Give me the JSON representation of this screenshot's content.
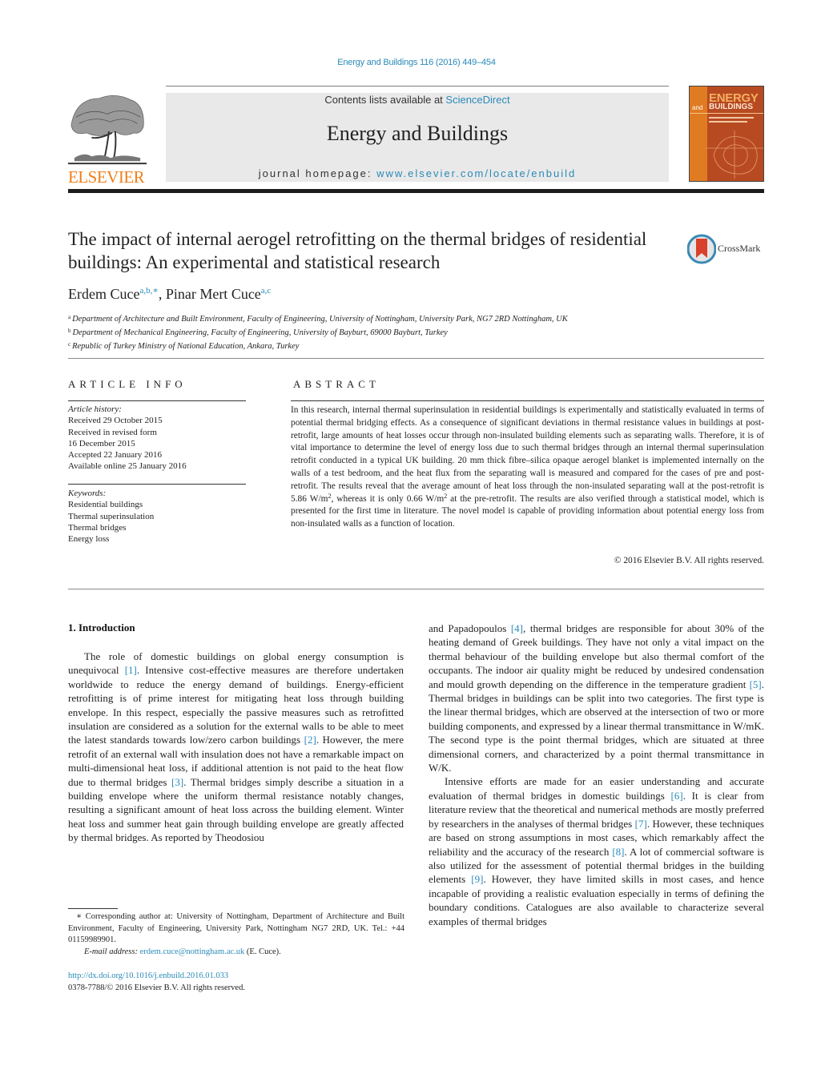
{
  "header": {
    "journal_citation": "Energy and Buildings 116 (2016) 449–454",
    "publisher_logo_text": "ELSEVIER",
    "contents_prefix": "Contents lists available at ",
    "contents_link": "ScienceDirect",
    "journal_title": "Energy and Buildings",
    "homepage_prefix": "journal homepage: ",
    "homepage_link": "www.elsevier.com/locate/enbuild",
    "cover": {
      "title_line1": "ENERGY",
      "title_and": "and",
      "title_line2": "BUILDINGS"
    },
    "colors": {
      "link": "#2a8ab8",
      "elsevier_orange": "#f07f1a",
      "masthead_bg": "#e9e9e9"
    }
  },
  "article": {
    "title": "The impact of internal aerogel retrofitting on the thermal bridges of residential buildings: An experimental and statistical research",
    "crossmark_label": "CrossMark",
    "authors": [
      {
        "name": "Erdem Cuce",
        "affil_marks": "a,b,∗"
      },
      {
        "name": "Pinar Mert Cuce",
        "affil_marks": "a,c"
      }
    ],
    "author_separator": ", ",
    "affiliations": [
      {
        "mark": "a",
        "text": "Department of Architecture and Built Environment, Faculty of Engineering, University of Nottingham, University Park, NG7 2RD Nottingham, UK"
      },
      {
        "mark": "b",
        "text": "Department of Mechanical Engineering, Faculty of Engineering, University of Bayburt, 69000 Bayburt, Turkey"
      },
      {
        "mark": "c",
        "text": "Republic of Turkey Ministry of National Education, Ankara, Turkey"
      }
    ]
  },
  "article_info": {
    "heading": "ARTICLE INFO",
    "history_label": "Article history:",
    "history": [
      "Received 29 October 2015",
      "Received in revised form",
      "16 December 2015",
      "Accepted 22 January 2016",
      "Available online 25 January 2016"
    ],
    "keywords_label": "Keywords:",
    "keywords": [
      "Residential buildings",
      "Thermal superinsulation",
      "Thermal bridges",
      "Energy loss"
    ]
  },
  "abstract": {
    "heading": "ABSTRACT",
    "text_part1": "In this research, internal thermal superinsulation in residential buildings is experimentally and statistically evaluated in terms of potential thermal bridging effects. As a consequence of significant deviations in thermal resistance values in buildings at post-retrofit, large amounts of heat losses occur through non-insulated building elements such as separating walls. Therefore, it is of vital importance to determine the level of energy loss due to such thermal bridges through an internal thermal superinsulation retrofit conducted in a typical UK building. 20 mm thick fibre–silica opaque aerogel blanket is implemented internally on the walls of a test bedroom, and the heat flux from the separating wall is measured and compared for the cases of pre and post-retrofit. The results reveal that the average amount of heat loss through the non-insulated separating wall at the post-retrofit is 5.86 W/m",
    "sup1": "2",
    "text_part2": ", whereas it is only 0.66 W/m",
    "sup2": "2",
    "text_part3": " at the pre-retrofit. The results are also verified through a statistical model, which is presented for the first time in literature. The novel model is capable of providing information about potential energy loss from non-insulated walls as a function of location.",
    "copyright": "© 2016 Elsevier B.V. All rights reserved."
  },
  "introduction": {
    "heading": "1.  Introduction",
    "left_column": [
      {
        "t": "The role of domestic buildings on global energy consumption is unequivocal "
      },
      {
        "ref": "[1]"
      },
      {
        "t": ". Intensive cost-effective measures are therefore undertaken worldwide to reduce the energy demand of buildings. Energy-efficient retrofitting is of prime interest for mitigating heat loss through building envelope. In this respect, especially the passive measures such as retrofitted insulation are considered as a solution for the external walls to be able to meet the latest standards towards low/zero carbon buildings "
      },
      {
        "ref": "[2]"
      },
      {
        "t": ". However, the mere retrofit of an external wall with insulation does not have a remarkable impact on multi-dimensional heat loss, if additional attention is not paid to the heat flow due to thermal bridges "
      },
      {
        "ref": "[3]"
      },
      {
        "t": ". Thermal bridges simply describe a situation in a building envelope where the uniform thermal resistance notably changes, resulting a significant amount of heat loss across the building element. Winter heat loss and summer heat gain through building envelope are greatly affected by thermal bridges. As reported by Theodosiou"
      }
    ],
    "right_column_p1": [
      {
        "t": "and Papadopoulos "
      },
      {
        "ref": "[4]"
      },
      {
        "t": ", thermal bridges are responsible for about 30% of the heating demand of Greek buildings. They have not only a vital impact on the thermal behaviour of the building envelope but also thermal comfort of the occupants. The indoor air quality might be reduced by undesired condensation and mould growth depending on the difference in the temperature gradient "
      },
      {
        "ref": "[5]"
      },
      {
        "t": ". Thermal bridges in buildings can be split into two categories. The first type is the linear thermal bridges, which are observed at the intersection of two or more building components, and expressed by a linear thermal transmittance in W/mK. The second type is the point thermal bridges, which are situated at three dimensional corners, and characterized by a point thermal transmittance in W/K."
      }
    ],
    "right_column_p2": [
      {
        "t": "Intensive efforts are made for an easier understanding and accurate evaluation of thermal bridges in domestic buildings "
      },
      {
        "ref": "[6]"
      },
      {
        "t": ". It is clear from literature review that the theoretical and numerical methods are mostly preferred by researchers in the analyses of thermal bridges "
      },
      {
        "ref": "[7]"
      },
      {
        "t": ". However, these techniques are based on strong assumptions in most cases, which remarkably affect the reliability and the accuracy of the research "
      },
      {
        "ref": "[8]"
      },
      {
        "t": ". A lot of commercial software is also utilized for the assessment of potential thermal bridges in the building elements "
      },
      {
        "ref": "[9]"
      },
      {
        "t": ". However, they have limited skills in most cases, and hence incapable of providing a realistic evaluation especially in terms of defining the boundary conditions. Catalogues are also available to characterize several examples of thermal bridges"
      }
    ]
  },
  "footnote": {
    "corresponding": "∗ Corresponding author at: University of Nottingham, Department of Architecture and Built Environment, Faculty of Engineering, University Park, Nottingham NG7 2RD, UK. Tel.: +44 01159989901.",
    "email_label": "E-mail address: ",
    "email": "erdem.cuce@nottingham.ac.uk",
    "email_suffix": " (E. Cuce).",
    "doi_link": "http://dx.doi.org/10.1016/j.enbuild.2016.01.033",
    "issn_copyright": "0378-7788/© 2016 Elsevier B.V. All rights reserved."
  }
}
